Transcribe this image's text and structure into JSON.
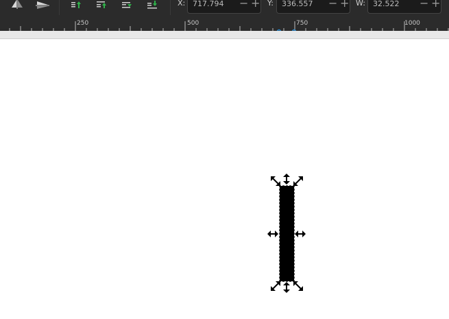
{
  "toolbar": {
    "icons": [
      "flip-horizontal-icon",
      "flip-vertical-icon",
      "raise-to-top-icon",
      "raise-icon",
      "lower-icon",
      "lower-to-bottom-icon"
    ],
    "x": {
      "label": "X:",
      "value": "717.794"
    },
    "y": {
      "label": "Y:",
      "value": "336.557"
    },
    "w": {
      "label": "W:",
      "value": "32.522"
    }
  },
  "ruler": {
    "labels": [
      "250",
      "500",
      "750",
      "1000"
    ]
  },
  "colors": {
    "chrome_bg": "#2b2b2b",
    "canvas_bg": "#ffffff",
    "selected_object": "#000000",
    "guide_accent": "#2a8fd8",
    "icon_green": "#2fb34a"
  }
}
